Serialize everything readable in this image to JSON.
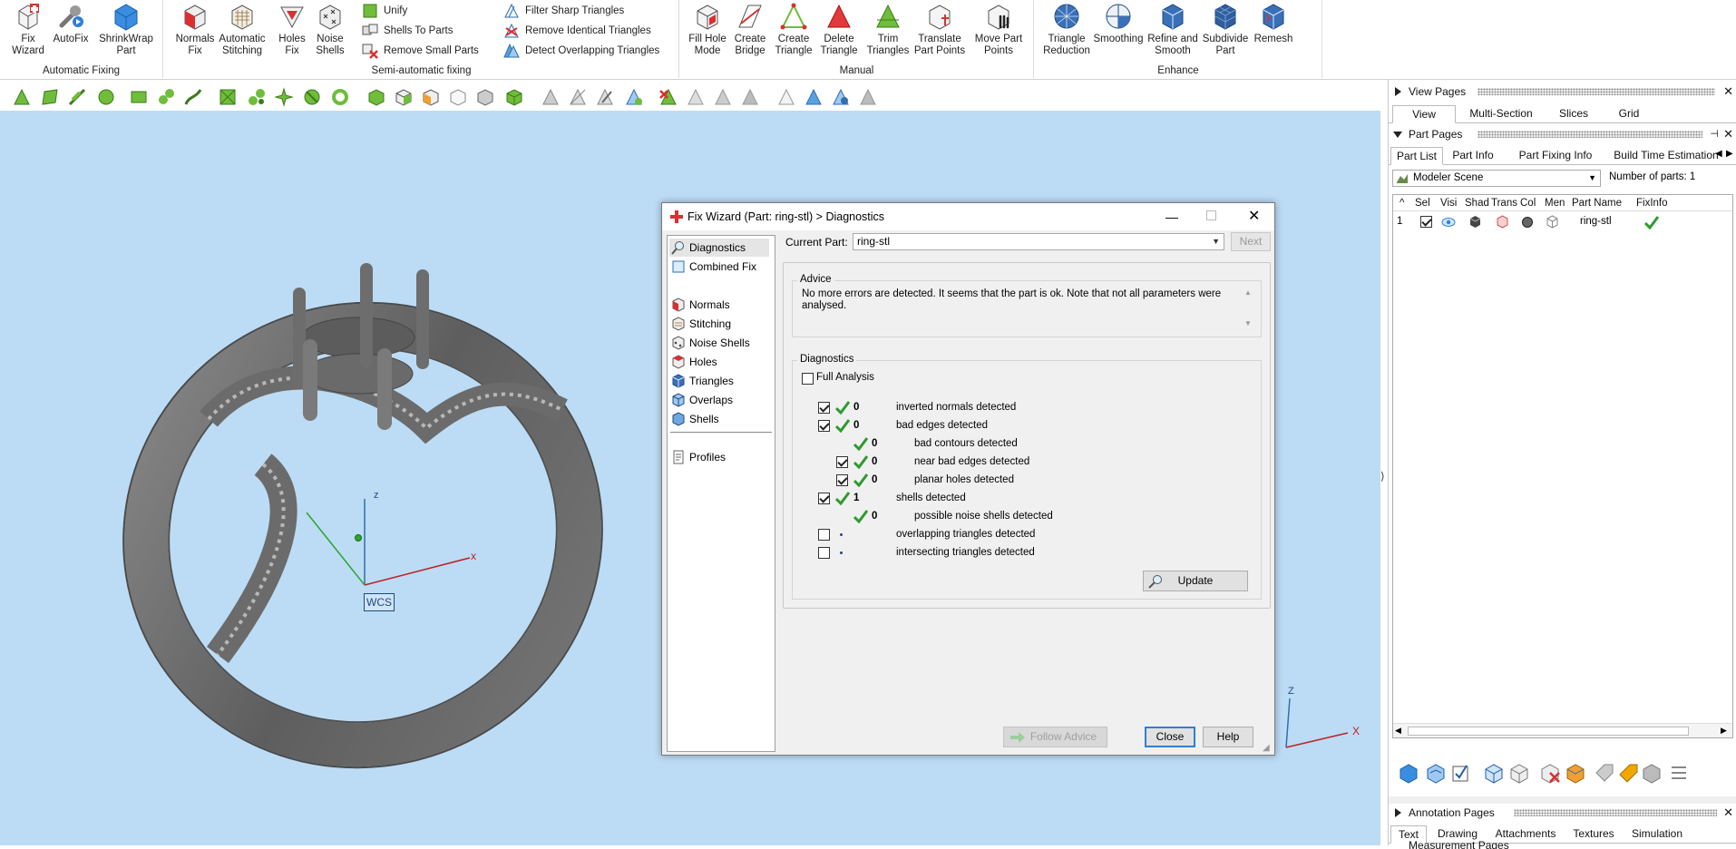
{
  "ribbon": {
    "groups": [
      {
        "name": "Automatic Fixing",
        "buttons": [
          "Fix Wizard",
          "AutoFix",
          "ShrinkWrap Part"
        ]
      },
      {
        "name": "Semi-automatic fixing",
        "buttons": [
          "Normals Fix",
          "Automatic Stitching",
          "Holes Fix",
          "Noise Shells"
        ],
        "small": [
          "Unify",
          "Shells To Parts",
          "Remove Small Parts",
          "Filter Sharp Triangles",
          "Remove Identical Triangles",
          "Detect Overlapping Triangles"
        ]
      },
      {
        "name": "Manual",
        "buttons": [
          "Fill Hole Mode",
          "Create Bridge",
          "Create Triangle",
          "Delete Triangle",
          "Trim Triangles",
          "Translate Part Points",
          "Move Part Points"
        ]
      },
      {
        "name": "Enhance",
        "buttons": [
          "Triangle Reduction",
          "Smoothing",
          "Refine and Smooth",
          "Subdivide Part",
          "Remesh"
        ]
      }
    ]
  },
  "labels": {
    "fix_wizard": [
      "Fix",
      "Wizard"
    ],
    "autofix": [
      "AutoFix",
      ""
    ],
    "shrinkwrap": [
      "ShrinkWrap",
      "Part"
    ],
    "normals_fix": [
      "Normals",
      "Fix"
    ],
    "auto_stitch": [
      "Automatic",
      "Stitching"
    ],
    "holes_fix": [
      "Holes",
      "Fix"
    ],
    "noise_shells": [
      "Noise",
      "Shells"
    ],
    "fill_hole": [
      "Fill Hole",
      "Mode"
    ],
    "create_bridge": [
      "Create",
      "Bridge"
    ],
    "create_triangle": [
      "Create",
      "Triangle"
    ],
    "delete_triangle": [
      "Delete",
      "Triangle"
    ],
    "trim_triangles": [
      "Trim",
      "Triangles"
    ],
    "translate_points": [
      "Translate",
      "Part Points"
    ],
    "move_points": [
      "Move Part",
      "Points"
    ],
    "triangle_reduction": [
      "Triangle",
      "Reduction"
    ],
    "smoothing": [
      "Smoothing",
      ""
    ],
    "refine_smooth": [
      "Refine and",
      "Smooth"
    ],
    "subdivide": [
      "Subdivide",
      "Part"
    ],
    "remesh": [
      "Remesh",
      ""
    ]
  },
  "viewport": {
    "wcs_label": "WCS",
    "axis_x": "x",
    "axis_z": "z",
    "corner_z": "Z",
    "corner_x": "X"
  },
  "dialog": {
    "title": "Fix Wizard (Part: ring-stl) > Diagnostics",
    "nav": [
      "Diagnostics",
      "Combined Fix",
      "Normals",
      "Stitching",
      "Noise Shells",
      "Holes",
      "Triangles",
      "Overlaps",
      "Shells",
      "Profiles"
    ],
    "current_part_label": "Current Part:",
    "current_part_value": "ring-stl",
    "next_label": "Next",
    "advice_title": "Advice",
    "advice_text": "No more errors are detected. It seems that the part is ok. Note that not all parameters were analysed.",
    "diagnostics_title": "Diagnostics",
    "full_analysis": "Full Analysis",
    "rows": [
      {
        "checked": true,
        "ok": true,
        "value": "0",
        "label": "inverted normals detected",
        "indent": 0,
        "has_check": true
      },
      {
        "checked": true,
        "ok": true,
        "value": "0",
        "label": "bad edges detected",
        "indent": 0,
        "has_check": true
      },
      {
        "checked": false,
        "ok": true,
        "value": "0",
        "label": "bad contours detected",
        "indent": 1,
        "has_check": false
      },
      {
        "checked": true,
        "ok": true,
        "value": "0",
        "label": "near bad edges detected",
        "indent": 1,
        "has_check": true
      },
      {
        "checked": true,
        "ok": true,
        "value": "0",
        "label": "planar holes detected",
        "indent": 1,
        "has_check": true
      },
      {
        "checked": true,
        "ok": true,
        "value": "1",
        "label": "shells detected",
        "indent": 0,
        "has_check": true
      },
      {
        "checked": false,
        "ok": true,
        "value": "0",
        "label": "possible noise shells detected",
        "indent": 1,
        "has_check": false
      },
      {
        "checked": false,
        "ok": false,
        "value": "",
        "label": "overlapping triangles detected",
        "indent": 0,
        "has_check": true
      },
      {
        "checked": false,
        "ok": false,
        "value": "",
        "label": "intersecting triangles detected",
        "indent": 0,
        "has_check": true
      }
    ],
    "update_label": "Update",
    "follow_advice_label": "Follow Advice",
    "close_label": "Close",
    "help_label": "Help"
  },
  "right_panel": {
    "view_pages": "View Pages",
    "view_tabs": [
      "View",
      "Multi-Section",
      "Slices",
      "Grid"
    ],
    "part_pages": "Part Pages",
    "part_tabs": [
      "Part List",
      "Part Info",
      "Part Fixing Info",
      "Build Time Estimation"
    ],
    "scene_select": "Modeler Scene",
    "num_parts_label": "Number of parts:",
    "num_parts_value": "1",
    "columns": [
      "^",
      "Sel",
      "Visi",
      "Shad",
      "Trans",
      "Col",
      "Men",
      "Part Name",
      "FixInfo"
    ],
    "row": {
      "index": "1",
      "part_name": "ring-stl"
    },
    "annotation_pages": "Annotation Pages",
    "annotation_tabs": [
      "Text",
      "Drawing",
      "Attachments",
      "Textures",
      "Simulation"
    ],
    "measurement_pages": "Measurement Pages"
  },
  "colors": {
    "viewport_bg": "#bcdcf5",
    "ok_green": "#2e9a2e",
    "accent_blue": "#2f7fd4",
    "ring": "#6f6f6f"
  }
}
